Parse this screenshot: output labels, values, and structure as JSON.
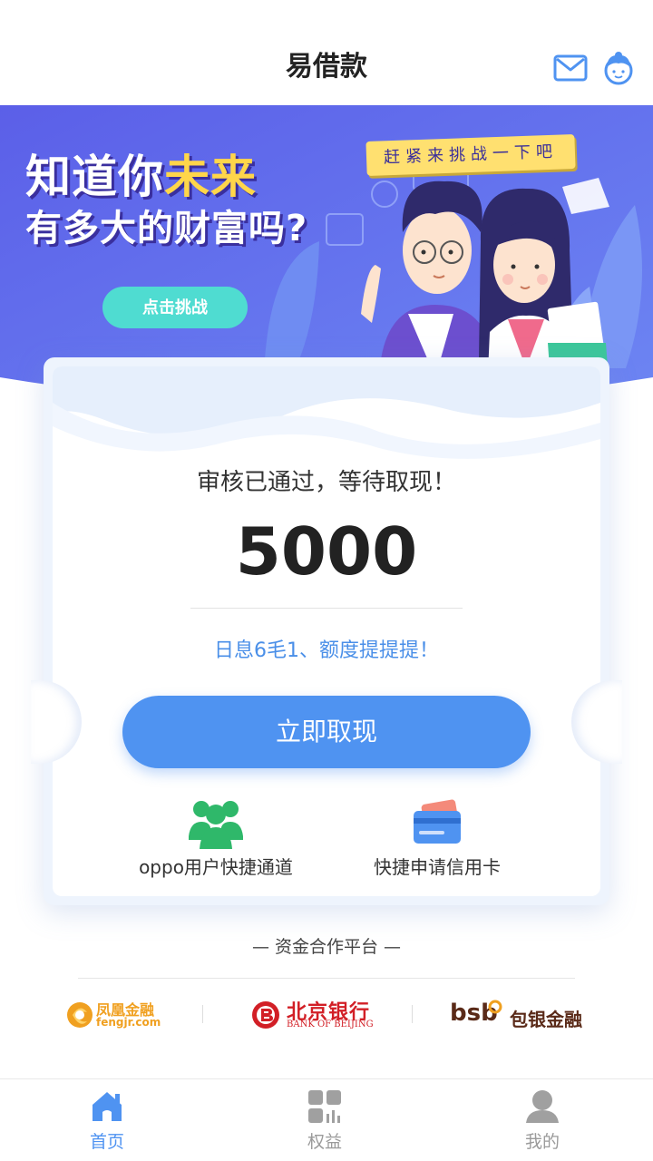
{
  "header": {
    "title": "易借款",
    "mail_icon": "mail-icon",
    "profile_icon": "user-avatar-icon"
  },
  "banner": {
    "headline_line1_a": "知道你",
    "headline_line1_b": "未来",
    "headline_line2": "有多大的财富吗?",
    "tag": "赶紧来挑战一下吧",
    "button": "点击挑战"
  },
  "card": {
    "status": "审核已通过，等待取现！",
    "amount": "5000",
    "rate_note": "日息6毛1、额度提提提！",
    "cash_button": "立即取现",
    "quick_links": [
      {
        "label": "oppo用户快捷通道",
        "icon": "users-group-icon"
      },
      {
        "label": "快捷申请信用卡",
        "icon": "credit-card-icon"
      }
    ]
  },
  "partners": {
    "title": "— 资金合作平台 —",
    "items": [
      {
        "name": "凤凰金融",
        "sub": "fengjr.com"
      },
      {
        "name": "北京银行",
        "sub": "BANK OF BEIJING"
      },
      {
        "name": "bsb",
        "sub": "包银金融"
      }
    ]
  },
  "nav": {
    "items": [
      {
        "label": "首页",
        "icon": "home-icon",
        "active": true
      },
      {
        "label": "权益",
        "icon": "grid-icon",
        "active": false
      },
      {
        "label": "我的",
        "icon": "person-icon",
        "active": false
      }
    ]
  },
  "colors": {
    "primary": "#4f93f1",
    "banner_bg": "#5a63e6",
    "highlight": "#ffd64a",
    "teal": "#4fdcd1",
    "green": "#2fb86a"
  }
}
